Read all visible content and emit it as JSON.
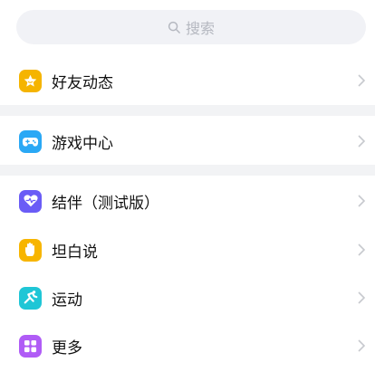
{
  "search": {
    "placeholder": "搜索"
  },
  "items": [
    {
      "label": "好友动态",
      "icon": "star-icon",
      "color": "#f5b400"
    },
    {
      "label": "游戏中心",
      "icon": "gamepad-icon",
      "color": "#2aa8f5"
    },
    {
      "label": "结伴（测试版）",
      "icon": "heart-pulse-icon",
      "color": "#6a5cf6"
    },
    {
      "label": "坦白说",
      "icon": "hand-icon",
      "color": "#f7b500"
    },
    {
      "label": "运动",
      "icon": "run-icon",
      "color": "#1fc6d6"
    },
    {
      "label": "更多",
      "icon": "grid-icon",
      "color": "#b05cf6"
    }
  ],
  "colors": {
    "search_bg": "#f1f2f6",
    "divider": "#f2f3f5",
    "chevron": "#c7c9ce"
  }
}
